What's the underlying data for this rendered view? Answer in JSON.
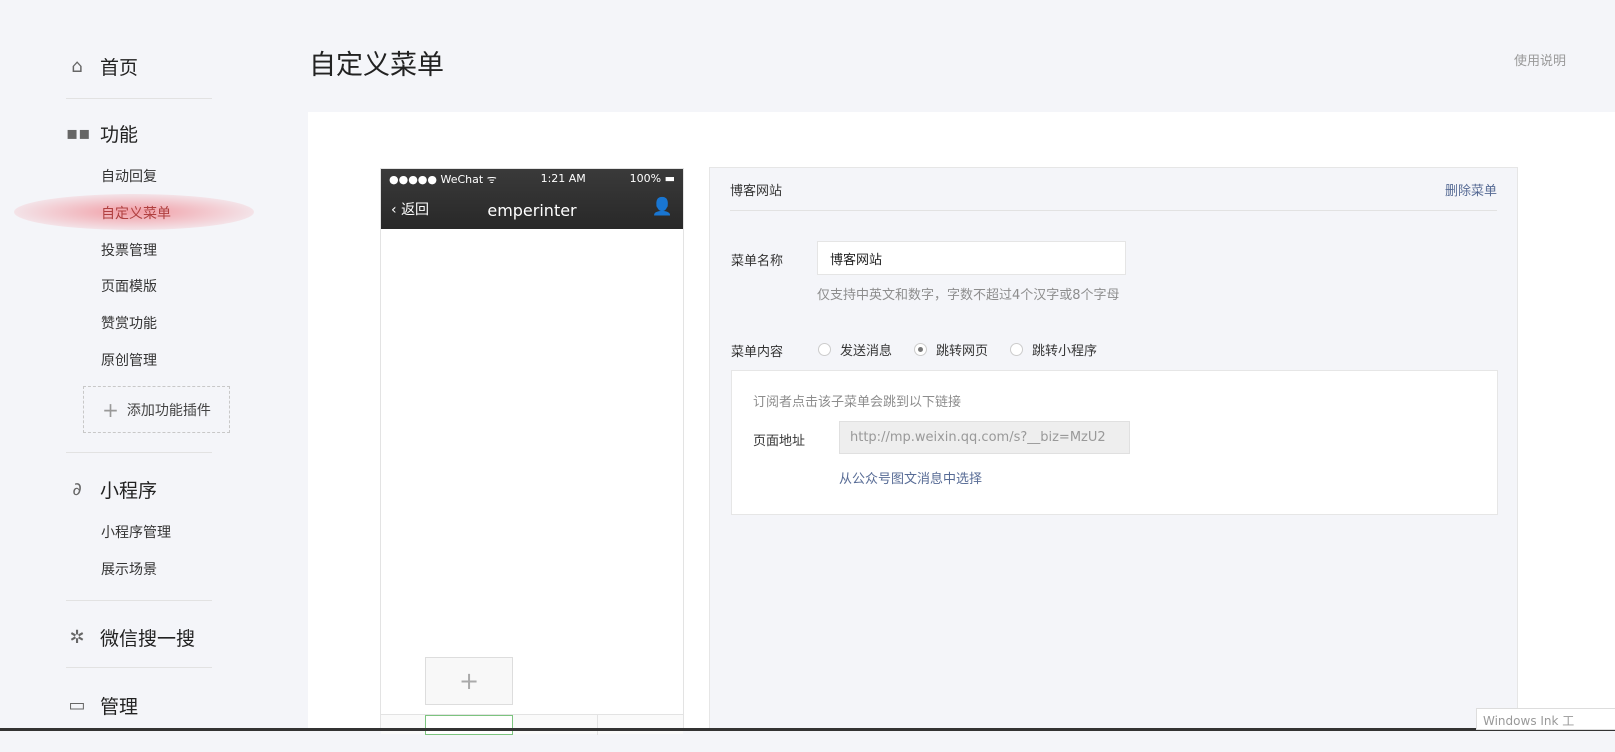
{
  "sidebar": {
    "home": "首页",
    "features": "功能",
    "feature_items": [
      "自动回复",
      "自定义菜单",
      "投票管理",
      "页面模版",
      "赞赏功能",
      "原创管理"
    ],
    "add_plugin": "添加功能插件",
    "miniprogram": "小程序",
    "mini_items": [
      "小程序管理",
      "展示场景"
    ],
    "search": "微信搜一搜",
    "manage": "管理"
  },
  "header": {
    "title": "自定义菜单",
    "help": "使用说明"
  },
  "phone": {
    "carrier": "●●●●● WeChat ᯤ",
    "time": "1:21 AM",
    "battery": "100% ▬",
    "back": "返回",
    "account": "emperinter",
    "add": "+"
  },
  "editor": {
    "menu_title": "博客网站",
    "delete": "删除菜单",
    "name_label": "菜单名称",
    "name_value": "博客网站",
    "name_tip": "仅支持中英文和数字，字数不超过4个汉字或8个字母",
    "content_label": "菜单内容",
    "options": [
      {
        "label": "发送消息",
        "checked": false
      },
      {
        "label": "跳转网页",
        "checked": true
      },
      {
        "label": "跳转小程序",
        "checked": false
      }
    ],
    "link_desc": "订阅者点击该子菜单会跳到以下链接",
    "url_label": "页面地址",
    "url_value": "http://mp.weixin.qq.com/s?__biz=MzU2",
    "pick_link": "从公众号图文消息中选择"
  },
  "overlay": {
    "windows_ink": "Windows Ink 工"
  }
}
